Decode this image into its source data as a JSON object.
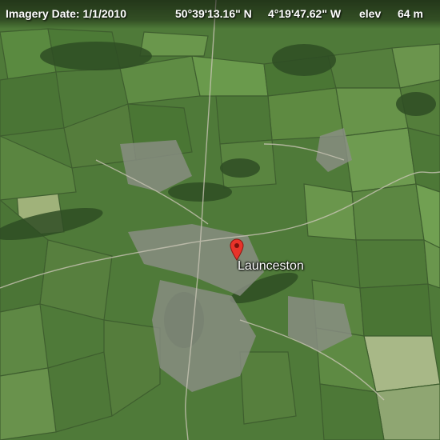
{
  "status_bar": {
    "imagery_date": "Imagery Date: 1/1/2010",
    "latitude": "50°39'13.16\" N",
    "longitude": "4°19'47.62\" W",
    "elevation_label": "elev",
    "elevation": "64 m"
  },
  "placemark": {
    "label": "Launceston",
    "icon": "map-pin-icon",
    "color": "#e8332a"
  },
  "imagery": {
    "type": "satellite",
    "field_color": "#4f7a39",
    "woodland_color": "#2f4d24",
    "urban_color": "#8b8f86"
  }
}
